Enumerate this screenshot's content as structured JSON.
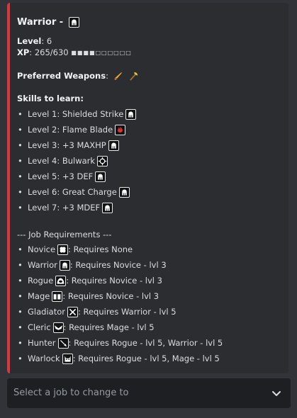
{
  "embed": {
    "title": "Warrior -",
    "accent_color": "#da373c",
    "level_label": "Level",
    "level_value": ": 6",
    "xp_label": "XP",
    "xp_value": ": 265/630",
    "xp_progress": 0.42,
    "xp_bar": "■■■■□□□□□□",
    "preferred_label": "Preferred Weapons",
    "preferred_weapons": [
      "sword-icon",
      "axe-icon"
    ],
    "skills_header": "Skills to learn:",
    "skills": [
      {
        "text": "Level 1: Shielded Strike",
        "icon": "helmet-icon"
      },
      {
        "text": "Level 2: Flame Blade",
        "icon": "flame-blade-icon"
      },
      {
        "text": "Level 3: +3 MAXHP",
        "icon": "helmet-icon"
      },
      {
        "text": "Level 4: Bulwark",
        "icon": "bulwark-icon"
      },
      {
        "text": "Level 5: +3 DEF",
        "icon": "helmet-icon"
      },
      {
        "text": "Level 6: Great Charge",
        "icon": "helmet-icon"
      },
      {
        "text": "Level 7: +3 MDEF",
        "icon": "helmet-icon"
      }
    ],
    "job_req_header": "--- Job Requirements ---",
    "jobs": [
      {
        "name": "Novice",
        "icon": "clover-icon",
        "req": ": Requires None"
      },
      {
        "name": "Warrior",
        "icon": "helmet-icon",
        "req": ": Requires Novice - lvl 3"
      },
      {
        "name": "Rogue",
        "icon": "hood-icon",
        "req": ": Requires Novice - lvl 3"
      },
      {
        "name": "Mage",
        "icon": "book-icon",
        "req": ": Requires Novice - lvl 3"
      },
      {
        "name": "Gladiator",
        "icon": "crossed-swords-icon",
        "req": ": Requires Warrior - lvl 5"
      },
      {
        "name": "Cleric",
        "icon": "wings-icon",
        "req": ": Requires Mage - lvl 5"
      },
      {
        "name": "Hunter",
        "icon": "arrow-icon",
        "req": ": Requires Rogue - lvl 5, Warrior - lvl 5"
      },
      {
        "name": "Warlock",
        "icon": "demon-icon",
        "req": ": Requires Rogue - lvl 5, Mage - lvl 5"
      }
    ]
  },
  "job_select": {
    "placeholder": "Select a job to change to"
  }
}
